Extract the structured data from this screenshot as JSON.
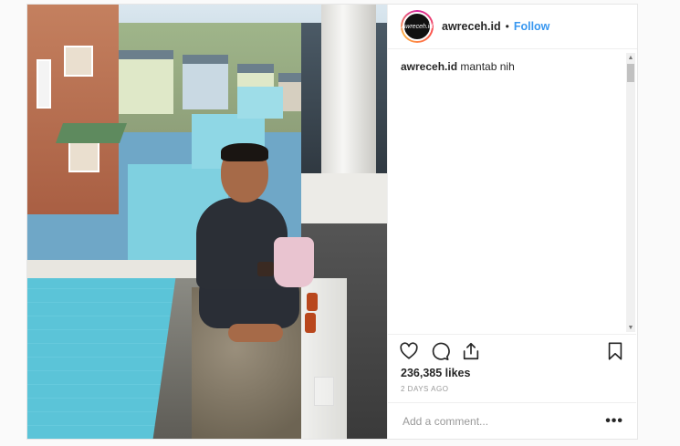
{
  "post": {
    "username": "awreceh.id",
    "avatar_text": "Awreceh.id",
    "separator": "•",
    "follow_label": "Follow",
    "caption_user": "awreceh.id",
    "caption_text": "mantab nih",
    "likes": "236,385 likes",
    "timestamp": "2 DAYS AGO",
    "comment_placeholder": "Add a comment...",
    "more_label": "•••"
  },
  "scrollbar": {
    "up": "▲",
    "down": "▼"
  },
  "icons": {
    "like": "heart-icon",
    "comment": "comment-icon",
    "share": "share-icon",
    "save": "bookmark-icon"
  },
  "colors": {
    "accent": "#3897f0",
    "border": "#efefef",
    "muted": "#999999"
  }
}
